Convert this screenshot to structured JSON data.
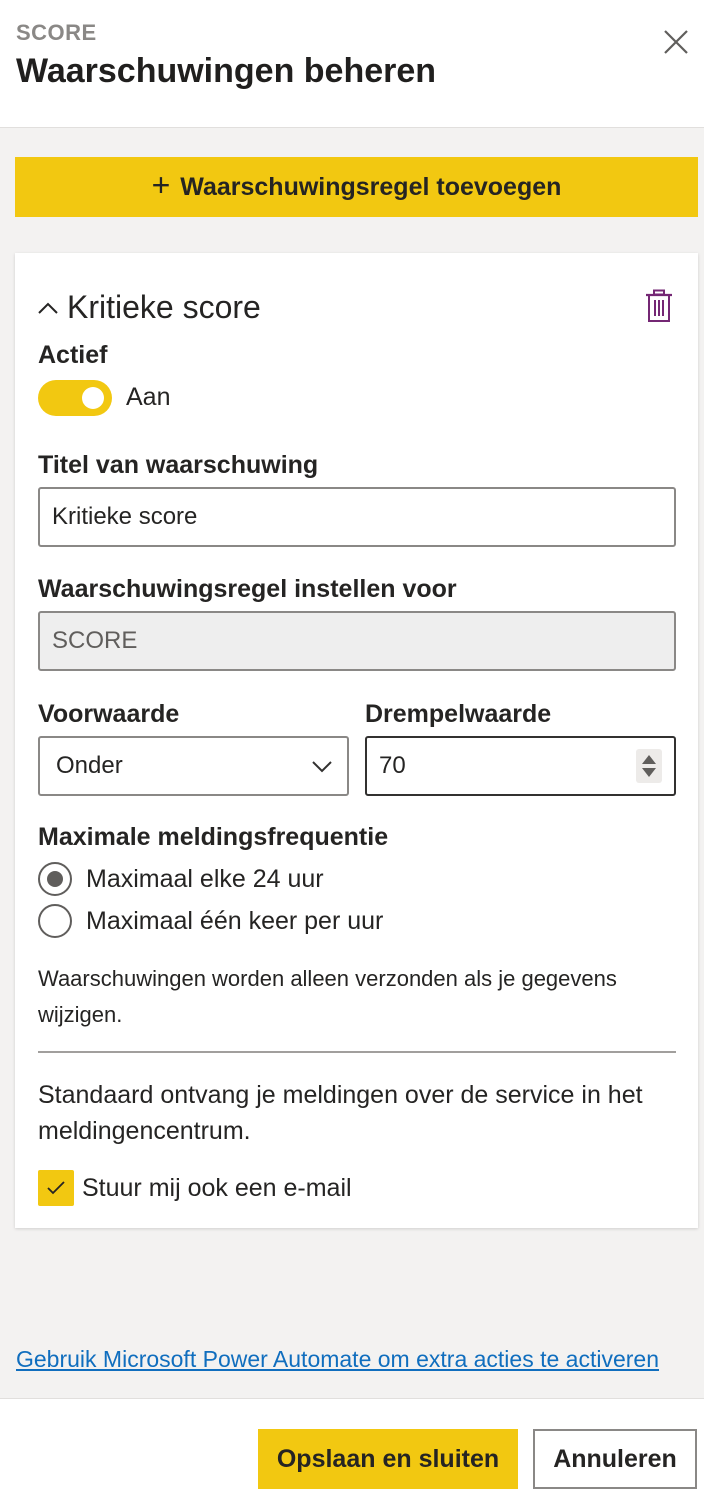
{
  "header": {
    "kicker": "SCORE",
    "title": "Waarschuwingen beheren"
  },
  "icons": {
    "close": "close-icon",
    "add": "plus-icon",
    "collapse": "chevron-up-icon",
    "delete": "trash-icon",
    "dropdown": "chevron-down-icon",
    "spinner": "spinner-arrows-icon",
    "check": "checkmark-icon"
  },
  "toolbar": {
    "add_rule_label": "Waarschuwingsregel toevoegen"
  },
  "rule": {
    "name": "Kritieke score",
    "active_label": "Actief",
    "active_state": "Aan",
    "title_label": "Titel van waarschuwing",
    "title_value": "Kritieke score",
    "target_label": "Waarschuwingsregel instellen voor",
    "target_value": "SCORE",
    "condition_label": "Voorwaarde",
    "condition_value": "Onder",
    "threshold_label": "Drempelwaarde",
    "threshold_value": "70",
    "frequency_label": "Maximale meldingsfrequentie",
    "frequency_options": [
      "Maximaal elke 24 uur",
      "Maximaal één keer per uur"
    ],
    "frequency_selected": "Maximaal elke 24 uur",
    "info_text": "Waarschuwingen worden alleen verzonden als je gegevens wijzigen.",
    "notification_text": "Standaard ontvang je meldingen over de service in het meldingencentrum.",
    "email_label": "Stuur mij ook een e-mail",
    "email_checked": true
  },
  "footer": {
    "link_text": "Gebruik Microsoft Power Automate om extra acties te activeren",
    "save_label": "Opslaan en sluiten",
    "cancel_label": "Annuleren"
  },
  "colors": {
    "accent": "#f2c811",
    "link": "#106ebe",
    "trash": "#742774"
  }
}
